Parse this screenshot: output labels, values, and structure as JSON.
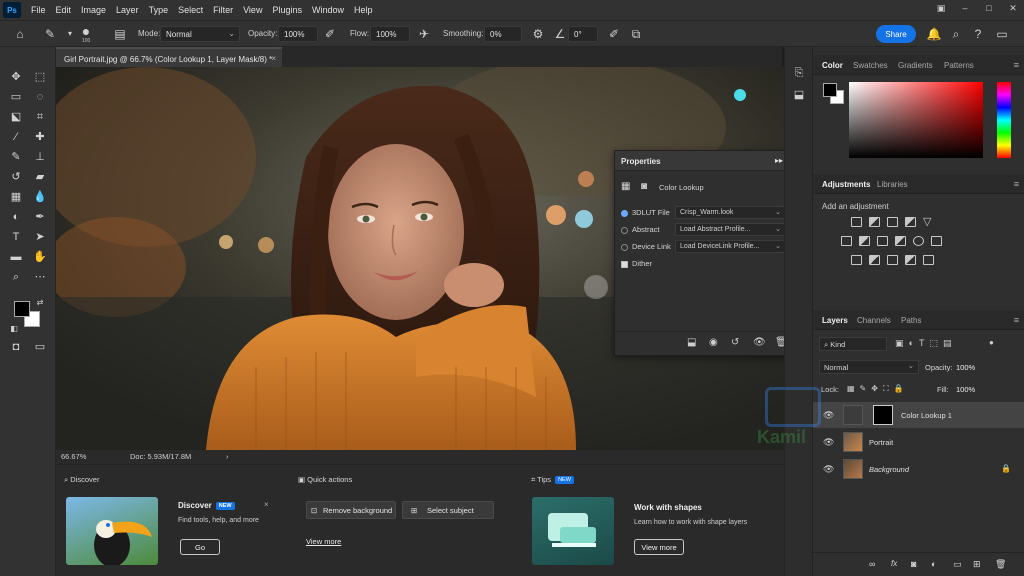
{
  "app": {
    "logo": "Ps"
  },
  "menu": [
    "File",
    "Edit",
    "Image",
    "Layer",
    "Type",
    "Select",
    "Filter",
    "View",
    "Plugins",
    "Window",
    "Help"
  ],
  "options": {
    "brush_size": "100",
    "mode_label": "Mode:",
    "mode_value": "Normal",
    "opacity_label": "Opacity:",
    "opacity_value": "100%",
    "flow_label": "Flow:",
    "flow_value": "100%",
    "smoothing_label": "Smoothing:",
    "smoothing_value": "0%",
    "angle_value": "0°",
    "share_label": "Share"
  },
  "document": {
    "tab_title": "Girl Portrait.jpg @ 66.7% (Color Lookup 1, Layer Mask/8) *",
    "zoom": "66.67%",
    "doc_size": "Doc: 5.93M/17.8M"
  },
  "properties": {
    "title": "Properties",
    "type_label": "Color Lookup",
    "rows": [
      {
        "label": "3DLUT File",
        "value": "Crisp_Warm.look",
        "selected": true
      },
      {
        "label": "Abstract",
        "value": "Load Abstract Profile...",
        "selected": false
      },
      {
        "label": "Device Link",
        "value": "Load DeviceLink Profile...",
        "selected": false
      }
    ],
    "dither_label": "Dither"
  },
  "color_panel": {
    "tabs": [
      "Color",
      "Swatches",
      "Gradients",
      "Patterns"
    ],
    "foreground": "#000000",
    "background": "#ffffff"
  },
  "adjustments_panel": {
    "tabs": [
      "Adjustments",
      "Libraries"
    ],
    "hint": "Add an adjustment"
  },
  "layers_panel": {
    "tabs": [
      "Layers",
      "Channels",
      "Paths"
    ],
    "filter_label": "Kind",
    "blend_mode": "Normal",
    "opacity_label": "Opacity:",
    "opacity_value": "100%",
    "lock_label": "Lock:",
    "fill_label": "Fill:",
    "fill_value": "100%",
    "layers": [
      {
        "name": "Color Lookup 1",
        "selected": true
      },
      {
        "name": "Portrait",
        "selected": false
      },
      {
        "name": "Background",
        "selected": false,
        "locked": true
      }
    ]
  },
  "bottom": {
    "discover": {
      "section": "Discover",
      "title": "Discover",
      "badge": "NEW",
      "desc": "Find tools, help, and more",
      "button": "Go"
    },
    "quick_actions": {
      "section": "Quick actions",
      "remove_bg": "Remove background",
      "select_subject": "Select subject",
      "view_more": "View more"
    },
    "tips": {
      "section": "Tips",
      "badge": "NEW",
      "title": "Work with shapes",
      "desc": "Learn how to work with shape layers",
      "button": "View more"
    }
  },
  "watermark": {
    "text": "Kamil"
  }
}
